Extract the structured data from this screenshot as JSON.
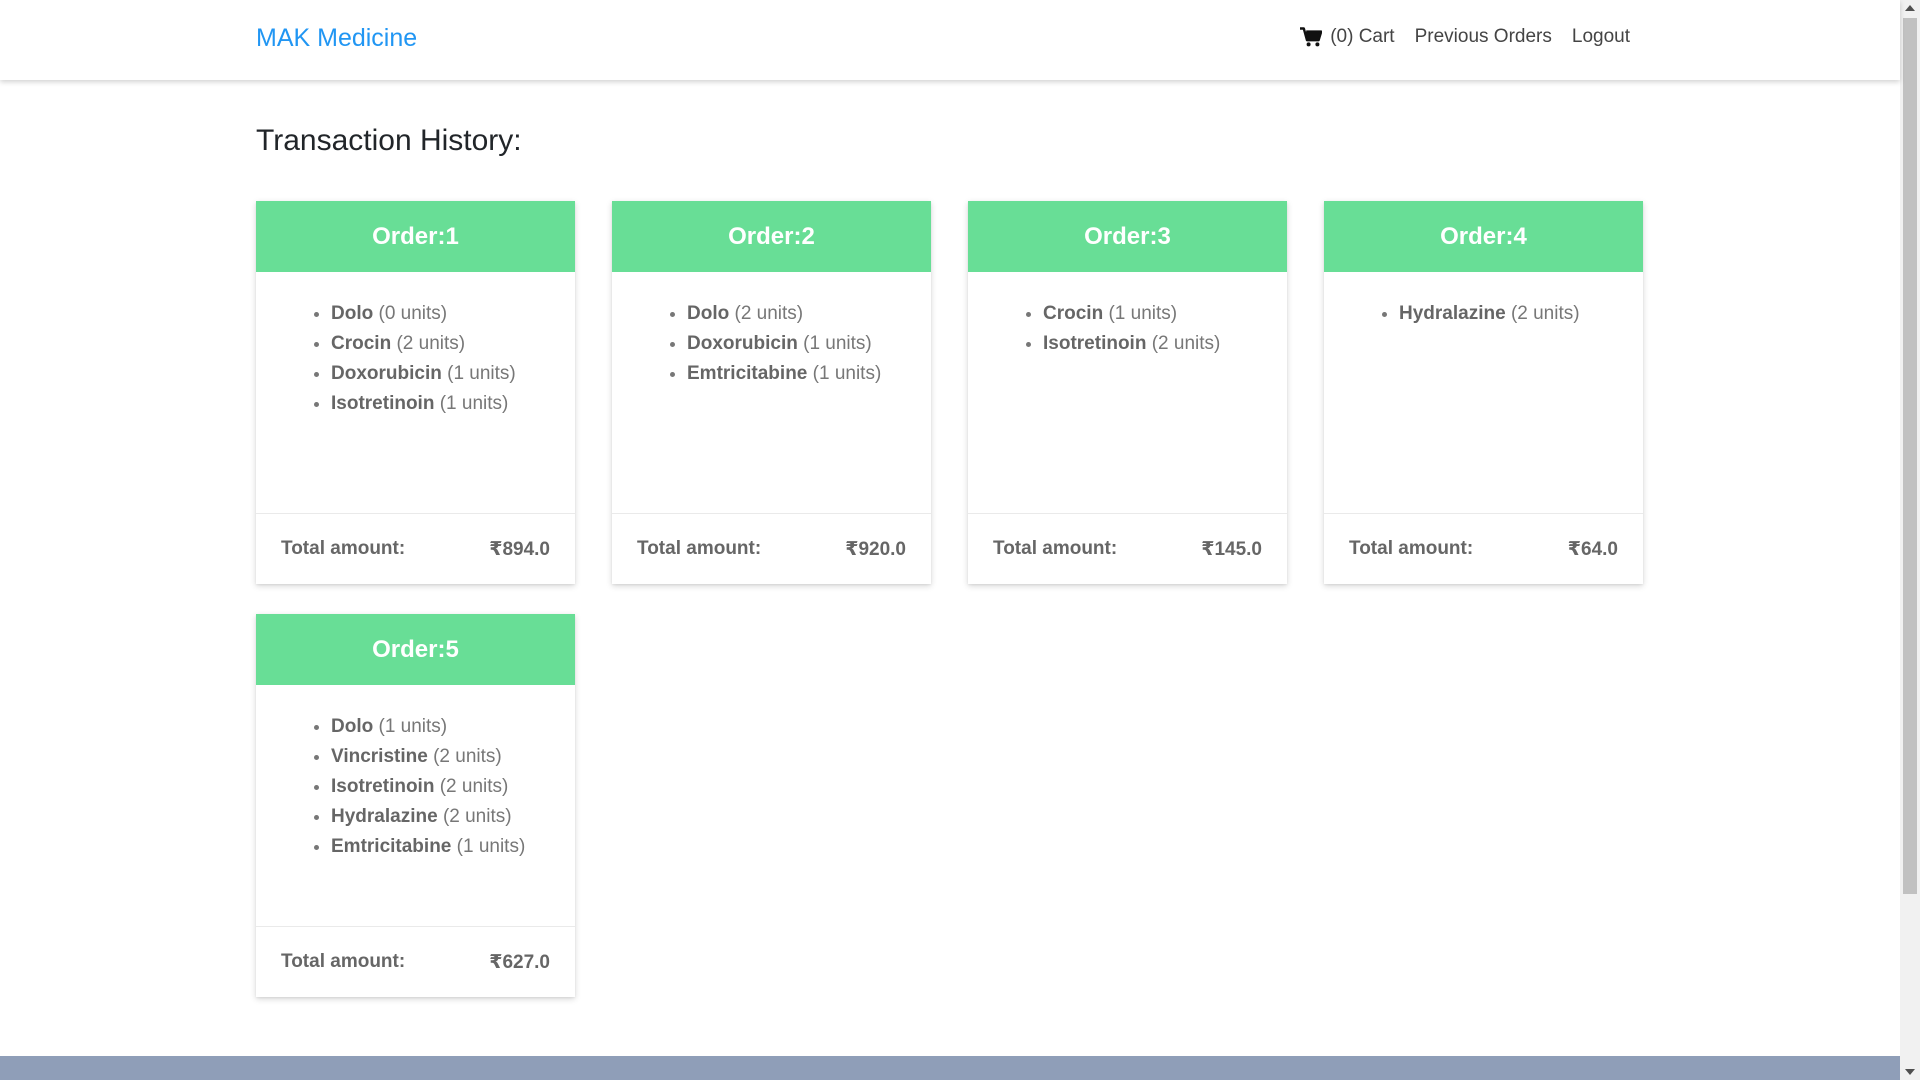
{
  "brand": "MAK Medicine",
  "nav": {
    "cart_label": "(0) Cart",
    "previous_orders_label": "Previous Orders",
    "logout_label": "Logout"
  },
  "page_title": "Transaction History:",
  "orders": [
    {
      "title": "Order:1",
      "items": [
        {
          "name": "Dolo",
          "qty": "(0 units)"
        },
        {
          "name": "Crocin",
          "qty": "(2 units)"
        },
        {
          "name": "Doxorubicin",
          "qty": "(1 units)"
        },
        {
          "name": "Isotretinoin",
          "qty": "(1 units)"
        }
      ],
      "total_label": "Total amount:",
      "total": "₹894.0"
    },
    {
      "title": "Order:2",
      "items": [
        {
          "name": "Dolo",
          "qty": "(2 units)"
        },
        {
          "name": "Doxorubicin",
          "qty": "(1 units)"
        },
        {
          "name": "Emtricitabine",
          "qty": "(1 units)"
        }
      ],
      "total_label": "Total amount:",
      "total": "₹920.0"
    },
    {
      "title": "Order:3",
      "items": [
        {
          "name": "Crocin",
          "qty": "(1 units)"
        },
        {
          "name": "Isotretinoin",
          "qty": "(2 units)"
        }
      ],
      "total_label": "Total amount:",
      "total": "₹145.0"
    },
    {
      "title": "Order:4",
      "items": [
        {
          "name": "Hydralazine",
          "qty": "(2 units)"
        }
      ],
      "total_label": "Total amount:",
      "total": "₹64.0"
    },
    {
      "title": "Order:5",
      "items": [
        {
          "name": "Dolo",
          "qty": "(1 units)"
        },
        {
          "name": "Vincristine",
          "qty": "(2 units)"
        },
        {
          "name": "Isotretinoin",
          "qty": "(2 units)"
        },
        {
          "name": "Hydralazine",
          "qty": "(2 units)"
        },
        {
          "name": "Emtricitabine",
          "qty": "(1 units)"
        }
      ],
      "total_label": "Total amount:",
      "total": "₹627.0"
    }
  ],
  "colors": {
    "brand": "#2196f3",
    "card_header": "#68de96",
    "footer_band": "#8f9eb8"
  }
}
